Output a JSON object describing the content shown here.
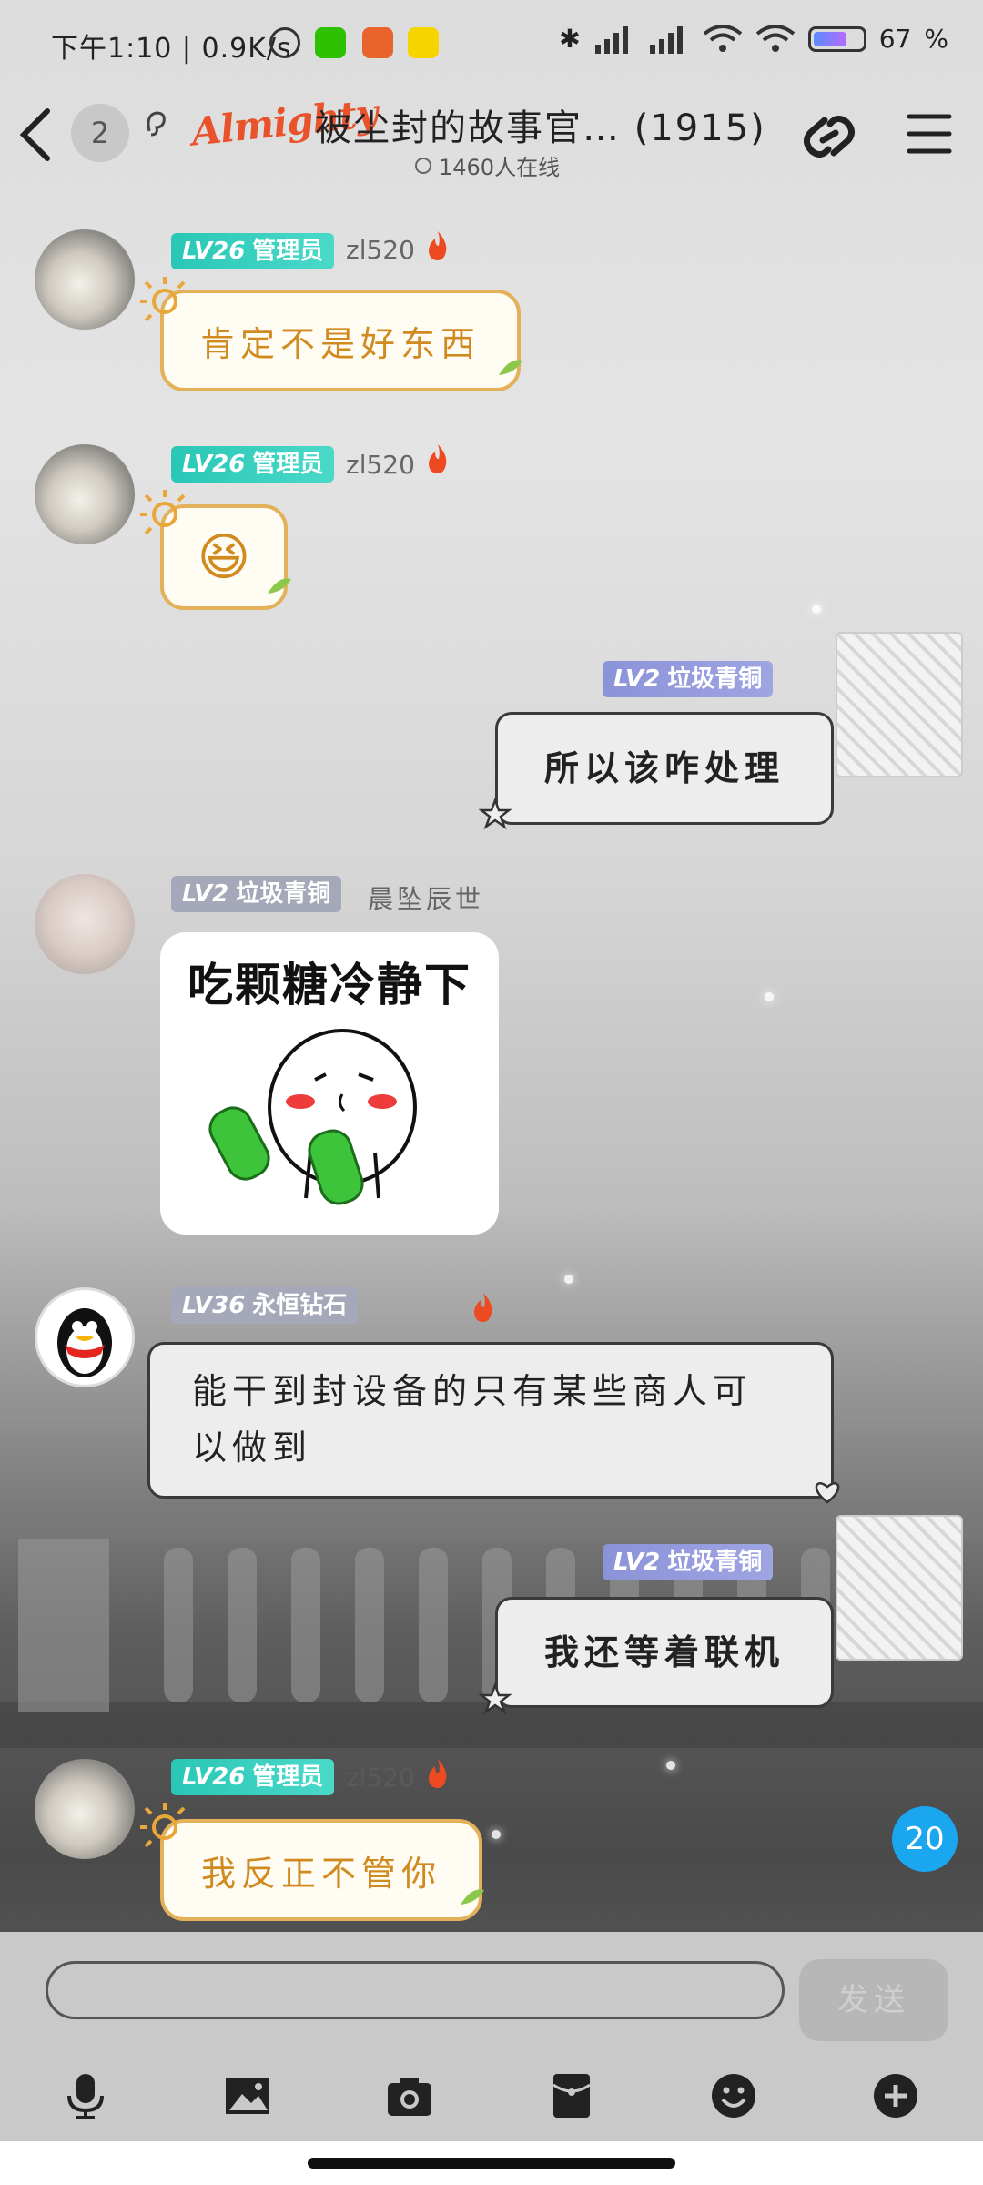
{
  "status": {
    "time": "下午1:10 | 0.9K/s",
    "battery": "67"
  },
  "header": {
    "unread": "2",
    "brand": "Almighty",
    "title": "被尘封的故事官…  (1915)",
    "online": "1460人在线"
  },
  "messages": [
    {
      "badge_lv": "LV26",
      "badge_title": "管理员",
      "nick": "zl520",
      "text": "肯定不是好东西"
    },
    {
      "badge_lv": "LV26",
      "badge_title": "管理员",
      "nick": "zl520",
      "emoji": "😆"
    },
    {
      "badge_lv": "LV2",
      "badge_title": "垃圾青铜",
      "text": "所以该咋处理"
    },
    {
      "badge_lv": "LV2",
      "badge_title": "垃圾青铜",
      "nick": "晨坠辰世",
      "sticker_text": "吃颗糖冷静下"
    },
    {
      "badge_lv": "LV36",
      "badge_title": "永恒钻石",
      "text": "能干到封设备的只有某些商人可以做到"
    },
    {
      "badge_lv": "LV2",
      "badge_title": "垃圾青铜",
      "text": "我还等着联机"
    },
    {
      "badge_lv": "LV26",
      "badge_title": "管理员",
      "nick": "zl520",
      "text": "我反正不管你"
    }
  ],
  "unread_badge": "20",
  "composer": {
    "input_value": "",
    "send_label": "发送"
  },
  "toolbar": [
    "mic-icon",
    "image-icon",
    "camera-icon",
    "redpacket-icon",
    "emoji-icon",
    "plus-icon"
  ]
}
